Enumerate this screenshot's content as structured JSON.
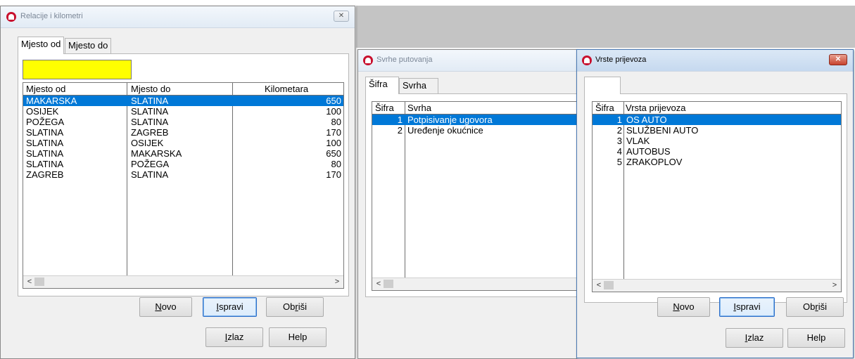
{
  "win1": {
    "title": "Relacije i kilometri",
    "close_label": "✕",
    "tabs": [
      "Mjesto od",
      "Mjesto do"
    ],
    "search_value": "",
    "columns": [
      "Mjesto od",
      "Mjesto do",
      "Kilometara"
    ],
    "rows": [
      {
        "od": "MAKARSKA",
        "do": "SLATINA",
        "km": "650"
      },
      {
        "od": "OSIJEK",
        "do": "SLATINA",
        "km": "100"
      },
      {
        "od": "POŽEGA",
        "do": "SLATINA",
        "km": "80"
      },
      {
        "od": "SLATINA",
        "do": "ZAGREB",
        "km": "170"
      },
      {
        "od": "SLATINA",
        "do": "OSIJEK",
        "km": "100"
      },
      {
        "od": "SLATINA",
        "do": "MAKARSKA",
        "km": "650"
      },
      {
        "od": "SLATINA",
        "do": "POŽEGA",
        "km": "80"
      },
      {
        "od": "ZAGREB",
        "do": "SLATINA",
        "km": "170"
      }
    ],
    "buttons": {
      "novo": {
        "pre": "",
        "ul": "N",
        "post": "ovo"
      },
      "ispravi": {
        "pre": "",
        "ul": "I",
        "post": "spravi"
      },
      "obrisi": {
        "pre": "Ob",
        "ul": "r",
        "post": "iši"
      },
      "izlaz": {
        "pre": "",
        "ul": "I",
        "post": "zlaz"
      },
      "help": "Help"
    }
  },
  "win2": {
    "title": "Svrhe putovanja",
    "tabs": [
      "Šifra",
      "Svrha"
    ],
    "columns": [
      "Šifra",
      "Svrha"
    ],
    "rows": [
      {
        "sifra": "1",
        "svrha": "Potpisivanje ugovora"
      },
      {
        "sifra": "2",
        "svrha": "Uređenje okućnice"
      }
    ]
  },
  "win3": {
    "title": "Vrste prijevoza",
    "close_label": "✕",
    "columns": [
      "Šifra",
      "Vrsta prijevoza"
    ],
    "rows": [
      {
        "sifra": "1",
        "vrsta": "OS AUTO"
      },
      {
        "sifra": "2",
        "vrsta": "SLUŽBENI AUTO"
      },
      {
        "sifra": "3",
        "vrsta": "VLAK"
      },
      {
        "sifra": "4",
        "vrsta": "AUTOBUS"
      },
      {
        "sifra": "5",
        "vrsta": "ZRAKOPLOV"
      }
    ],
    "buttons": {
      "novo": {
        "pre": "",
        "ul": "N",
        "post": "ovo"
      },
      "ispravi": {
        "pre": "",
        "ul": "I",
        "post": "spravi"
      },
      "obrisi": {
        "pre": "Ob",
        "ul": "r",
        "post": "iši"
      },
      "izlaz": {
        "pre": "",
        "ul": "I",
        "post": "zlaz"
      },
      "help": "Help"
    }
  },
  "scroll_left": "<",
  "scroll_right": ">"
}
